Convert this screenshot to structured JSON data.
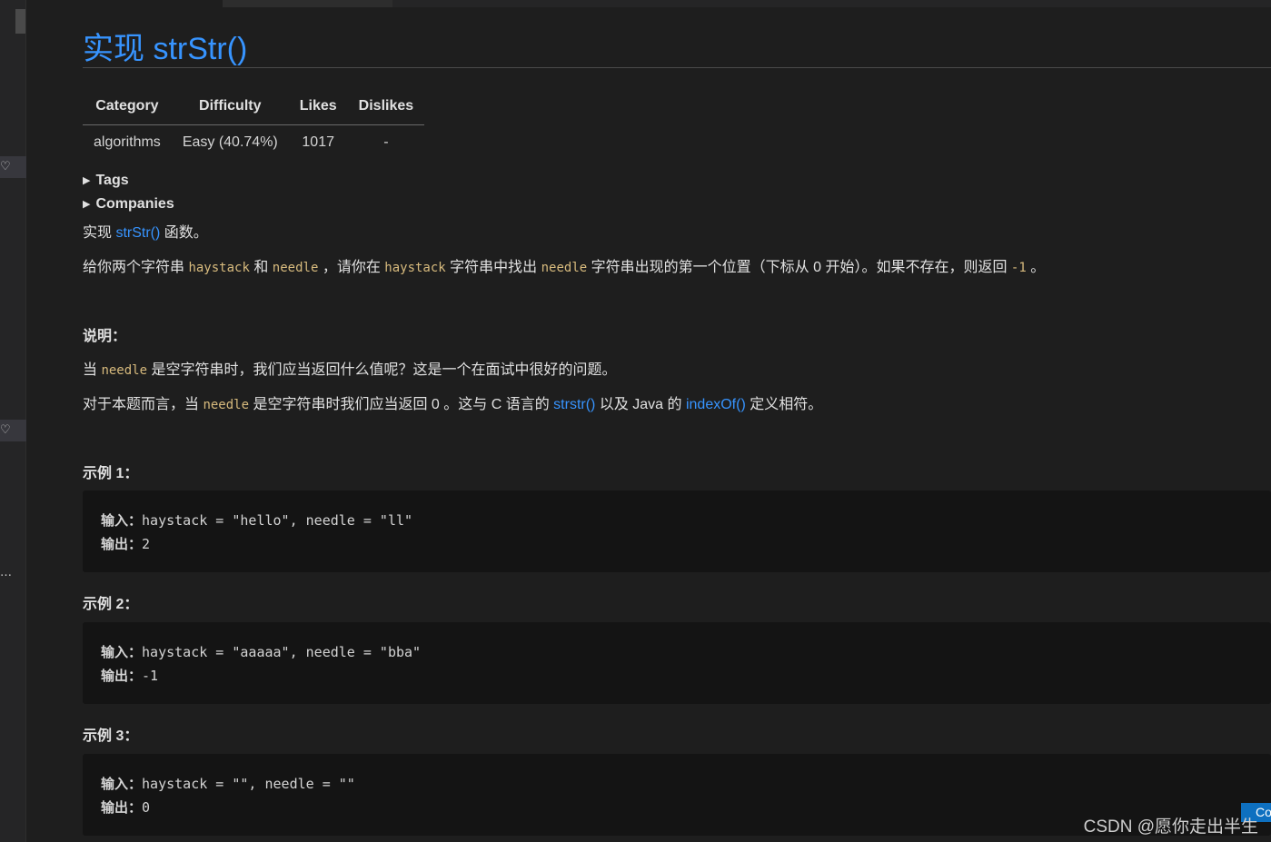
{
  "title": "实现 strStr()",
  "meta_table": {
    "headers": [
      "Category",
      "Difficulty",
      "Likes",
      "Dislikes"
    ],
    "row": [
      "algorithms",
      "Easy (40.74%)",
      "1017",
      "-"
    ]
  },
  "details": {
    "tags": "Tags",
    "companies": "Companies"
  },
  "intro": {
    "pre": "实现 ",
    "link": "strStr()",
    "post": " 函数。"
  },
  "desc": {
    "p1": "给你两个字符串 ",
    "c1": "haystack",
    "p2": " 和 ",
    "c2": "needle",
    "p3": " ，请你在 ",
    "c3": "haystack",
    "p4": " 字符串中找出 ",
    "c4": "needle",
    "p5": " 字符串出现的第一个位置（下标从 0 开始）。如果不存在，则返回 ",
    "c5": "-1",
    "p6": " 。"
  },
  "note": {
    "heading": "说明：",
    "line1_pre": "当 ",
    "line1_code": "needle",
    "line1_post": " 是空字符串时，我们应当返回什么值呢？这是一个在面试中很好的问题。",
    "line2_pre": "对于本题而言，当 ",
    "line2_code": "needle",
    "line2_mid": " 是空字符串时我们应当返回 0 。这与 C 语言的 ",
    "line2_link1": "strstr()",
    "line2_mid2": " 以及 Java 的 ",
    "line2_link2": "indexOf()",
    "line2_post": " 定义相符。"
  },
  "examples": [
    {
      "heading": "示例 1：",
      "input_label": "输入：",
      "input": "haystack = \"hello\", needle = \"ll\"",
      "output_label": "输出：",
      "output": "2"
    },
    {
      "heading": "示例 2：",
      "input_label": "输入：",
      "input": "haystack = \"aaaaa\", needle = \"bba\"",
      "output_label": "输出：",
      "output": "-1"
    },
    {
      "heading": "示例 3：",
      "input_label": "输入：",
      "input": "haystack = \"\", needle = \"\"",
      "output_label": "输出：",
      "output": "0"
    }
  ],
  "gutter": {
    "dots": "…"
  },
  "watermark": "CSDN @愿你走出半生",
  "corner_badge": "Co",
  "colors": {
    "background": "#1e1e1e",
    "link": "#3794ff",
    "code": "#d7ba7d",
    "code_block_bg": "#141414"
  },
  "icons": [
    "heart-icon",
    "triangle-right-icon"
  ]
}
